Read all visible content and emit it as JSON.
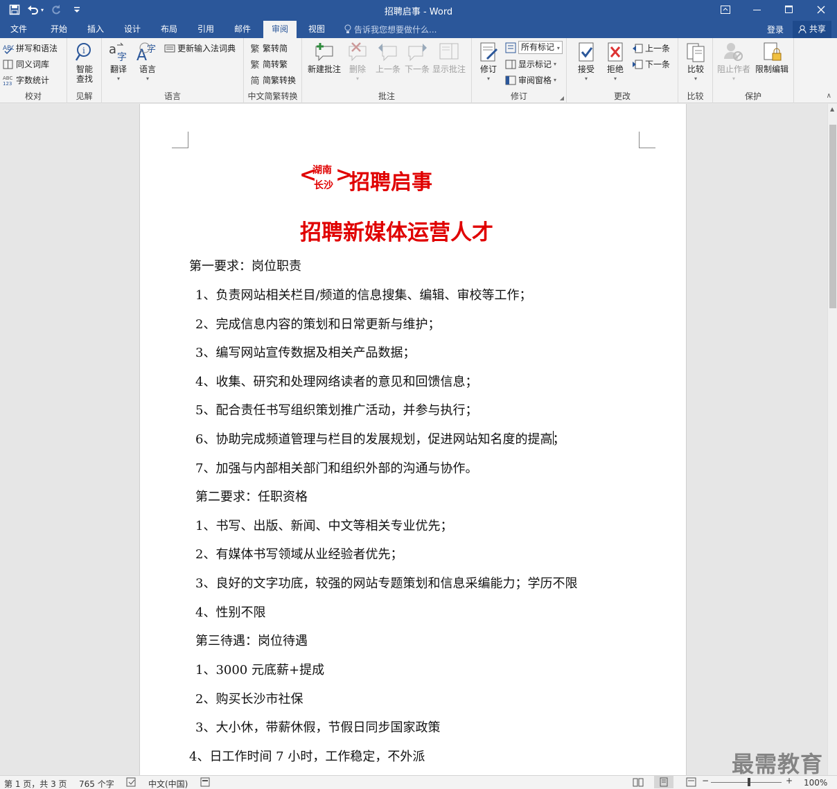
{
  "window": {
    "title": "招聘启事 - Word"
  },
  "qat": {
    "save": "💾",
    "undo": "↶",
    "redo": "↻",
    "customize": "⋯"
  },
  "tabs": [
    "文件",
    "开始",
    "插入",
    "设计",
    "布局",
    "引用",
    "邮件",
    "审阅",
    "视图"
  ],
  "active_tab": "审阅",
  "tell_me": "告诉我您想要做什么...",
  "account": {
    "login": "登录",
    "share": "共享"
  },
  "ribbon": {
    "proofing": {
      "label": "校对",
      "spelling": "拼写和语法",
      "thesaurus": "同义词库",
      "word_count": "字数统计"
    },
    "insights": {
      "label": "见解",
      "smart_lookup_1": "智能",
      "smart_lookup_2": "查找"
    },
    "language": {
      "label": "语言",
      "translate": "翻译",
      "language": "语言",
      "update_ime": "更新输入法词典"
    },
    "chinese_conversion": {
      "label": "中文简繁转换",
      "to_simplified": "繁转简",
      "to_traditional": "简转繁",
      "conversion": "简繁转换"
    },
    "comments": {
      "label": "批注",
      "new": "新建批注",
      "delete": "删除",
      "previous": "上一条",
      "next": "下一条",
      "show": "显示批注"
    },
    "tracking": {
      "label": "修订",
      "track_changes": "修订",
      "markup": "所有标记",
      "show_markup": "显示标记",
      "review_pane": "审阅窗格"
    },
    "changes": {
      "label": "更改",
      "accept": "接受",
      "reject": "拒绝",
      "previous": "上一条",
      "next": "下一条"
    },
    "compare": {
      "label": "比较",
      "compare": "比较"
    },
    "protect": {
      "label": "保护",
      "block_authors": "阻止作者",
      "restrict_editing": "限制编辑"
    }
  },
  "document": {
    "title_small_top": "湖南",
    "title_small_bottom": "长沙",
    "title_lt": "<",
    "title_gt": ">",
    "title_main": "招聘启事",
    "subtitle": "招聘新媒体运营人才",
    "lines": [
      "第一要求：岗位职责",
      "1、负责网站相关栏目/频道的信息搜集、编辑、审校等工作；",
      "2、完成信息内容的策划和日常更新与维护；",
      "3、编写网站宣传数据及相关产品数据；",
      "4、收集、研究和处理网络读者的意见和回馈信息；",
      "5、配合责任书写组织策划推广活动，并参与执行；",
      "6、协助完成频道管理与栏目的发展规划，促进网站知名度的提高；",
      "7、加强与内部相关部门和组织外部的沟通与协作。",
      "第二要求：任职资格",
      "1、书写、出版、新闻、中文等相关专业优先；",
      "2、有媒体书写领域从业经验者优先；",
      "3、良好的文字功底，较强的网站专题策划和信息采编能力；学历不限",
      "4、性别不限",
      "第三待遇：岗位待遇",
      "1、3000 元底薪+提成",
      "2、购买长沙市社保",
      "3、大小休，带薪休假，节假日同步国家政策",
      "4、日工作时间 7 小时，工作稳定，不外派"
    ]
  },
  "status": {
    "page": "第 1 页，共 3 页",
    "words": "765 个字",
    "language": "中文(中国)",
    "zoom": "100%",
    "zoom_minus": "−",
    "zoom_plus": "+"
  },
  "watermark": "最需教育",
  "colors": {
    "accent": "#2b579a",
    "title_red": "#e00000"
  }
}
